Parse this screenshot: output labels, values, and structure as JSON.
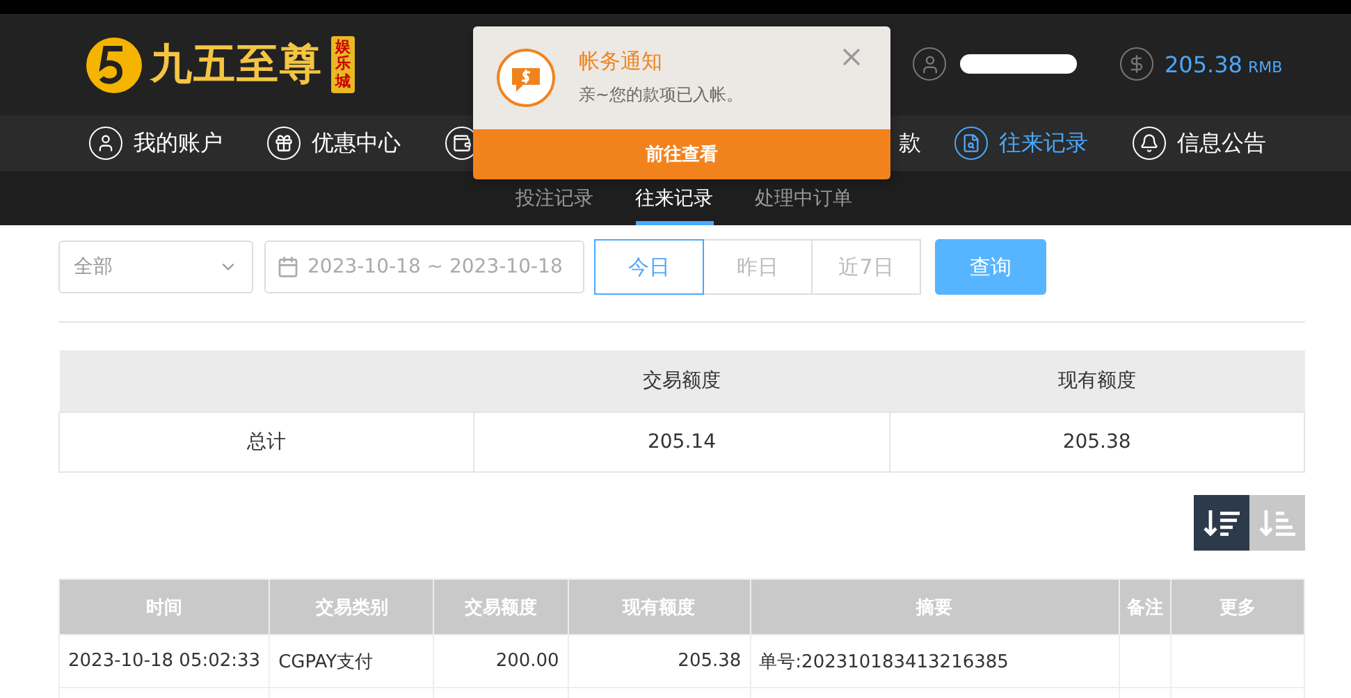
{
  "header": {
    "logo_text": "九五至尊",
    "logo_badge": "娱乐城",
    "balance": "205.38",
    "currency": "RMB"
  },
  "nav": [
    {
      "kind": "full",
      "label": "我的账户",
      "selected": false
    },
    {
      "kind": "full",
      "label": "优惠中心",
      "selected": false
    },
    {
      "kind": "icon_only",
      "selected": false
    },
    {
      "kind": "text_end",
      "label": "款",
      "selected": false
    },
    {
      "kind": "full",
      "label": "往来记录",
      "selected": true
    },
    {
      "kind": "full",
      "label": "信息公告",
      "selected": false
    }
  ],
  "subnav": [
    {
      "label": "投注记录",
      "selected": false
    },
    {
      "label": "往来记录",
      "selected": true
    },
    {
      "label": "处理中订单",
      "selected": false
    }
  ],
  "filters": {
    "type": "全部",
    "date_range": "2023-10-18 ~ 2023-10-18",
    "ranges": [
      {
        "label": "今日",
        "selected": true
      },
      {
        "label": "昨日",
        "selected": false
      },
      {
        "label": "近7日",
        "selected": false
      }
    ],
    "query_button": "查询"
  },
  "summary": {
    "headers": [
      "交易额度",
      "现有额度"
    ],
    "row_label": "总计",
    "values": [
      "205.14",
      "205.38"
    ]
  },
  "sort_buttons": [
    {
      "kind": "desc",
      "selected": true
    },
    {
      "kind": "asc",
      "selected": false
    }
  ],
  "table": {
    "columns": [
      "时间",
      "交易类别",
      "交易额度",
      "现有额度",
      "摘要",
      "备注",
      "更多"
    ],
    "rows": [
      [
        "2023-10-18 05:02:33",
        "CGPAY支付",
        "200.00",
        "205.38",
        "单号:202310183413216385"
      ]
    ]
  },
  "notification": {
    "title": "帐务通知",
    "message": "亲~您的款项已入帐。",
    "action": "前往查看"
  }
}
